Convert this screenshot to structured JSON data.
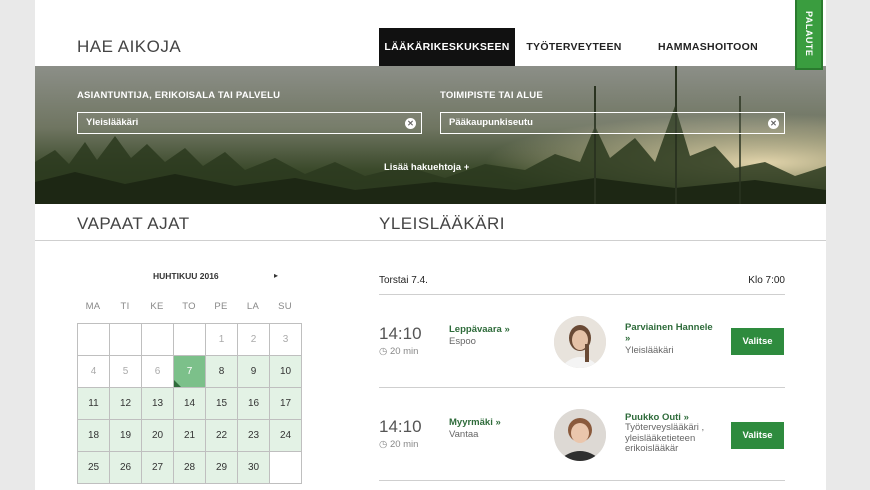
{
  "header": {
    "title": "HAE AIKOJA",
    "tabs": [
      {
        "label": "LÄÄKÄRIKESKUKSEEN",
        "active": true
      },
      {
        "label": "TYÖTERVEYTEEN",
        "active": false
      },
      {
        "label": "HAMMASHOITOON",
        "active": false
      }
    ]
  },
  "feedback": {
    "label": "PALAUTE"
  },
  "search": {
    "specialty_label": "ASIANTUNTIJA, ERIKOISALA TAI PALVELU",
    "specialty_value": "Yleislääkäri",
    "location_label": "TOIMIPISTE TAI ALUE",
    "location_value": "Pääkaupunkiseutu",
    "more_filters": "Lisää hakuehtoja +"
  },
  "calendar": {
    "section_title": "VAPAAT AJAT",
    "month": "HUHTIKUU 2016",
    "next": "▸",
    "weekdays": [
      "MA",
      "TI",
      "KE",
      "TO",
      "PE",
      "LA",
      "SU"
    ],
    "days": [
      "",
      "",
      "",
      "",
      "1",
      "2",
      "3",
      "4",
      "5",
      "6",
      "7",
      "8",
      "9",
      "10",
      "11",
      "12",
      "13",
      "14",
      "15",
      "16",
      "17",
      "18",
      "19",
      "20",
      "21",
      "22",
      "23",
      "24",
      "25",
      "26",
      "27",
      "28",
      "29",
      "30",
      ""
    ],
    "selected": "7"
  },
  "results": {
    "section_title": "YLEISLÄÄKÄRI",
    "date": "Torstai 7.4.",
    "time_label": "Klo 7:00",
    "appointments": [
      {
        "time": "14:10",
        "duration": "20 min",
        "location": "Leppävaara »",
        "city": "Espoo",
        "doctor": "Parviainen Hannele »",
        "specialty": "Yleislääkäri",
        "button": "Valitse"
      },
      {
        "time": "14:10",
        "duration": "20 min",
        "location": "Myyrmäki »",
        "city": "Vantaa",
        "doctor": "Puukko Outi »",
        "specialty": "Työterveyslääkäri , yleislääketieteen erikoislääkär",
        "button": "Valitse"
      }
    ]
  },
  "colors": {
    "accent": "#2e8b3e",
    "selected_day": "#7cc08a",
    "available_day": "#e3f2e5",
    "active_tab": "#111111"
  }
}
